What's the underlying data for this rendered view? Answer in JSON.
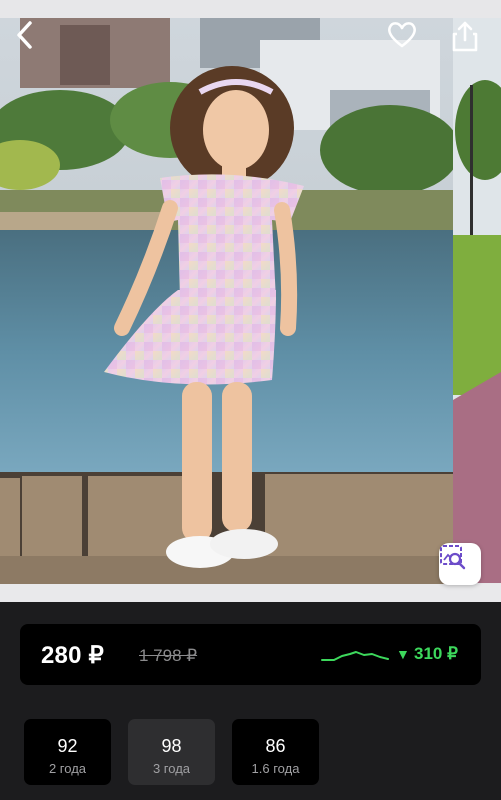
{
  "header": {
    "back_icon": "chevron-left-icon",
    "favorite_icon": "heart-outline-icon",
    "share_icon": "share-icon"
  },
  "photo": {
    "visual_search_icon": "image-search-icon"
  },
  "price": {
    "current": "280 ₽",
    "old": "1 798 ₽",
    "trend_arrow": "▼",
    "trend_value": "310 ₽",
    "trend_color": "#3dd85c"
  },
  "sizes": [
    {
      "size": "92",
      "age": "2 года",
      "selected": false
    },
    {
      "size": "98",
      "age": "3 года",
      "selected": true
    },
    {
      "size": "86",
      "age": "1.6 года",
      "selected": false
    }
  ],
  "colors": {
    "background": "#1c1c1e",
    "card": "#000000",
    "accent_green": "#3dd85c"
  }
}
